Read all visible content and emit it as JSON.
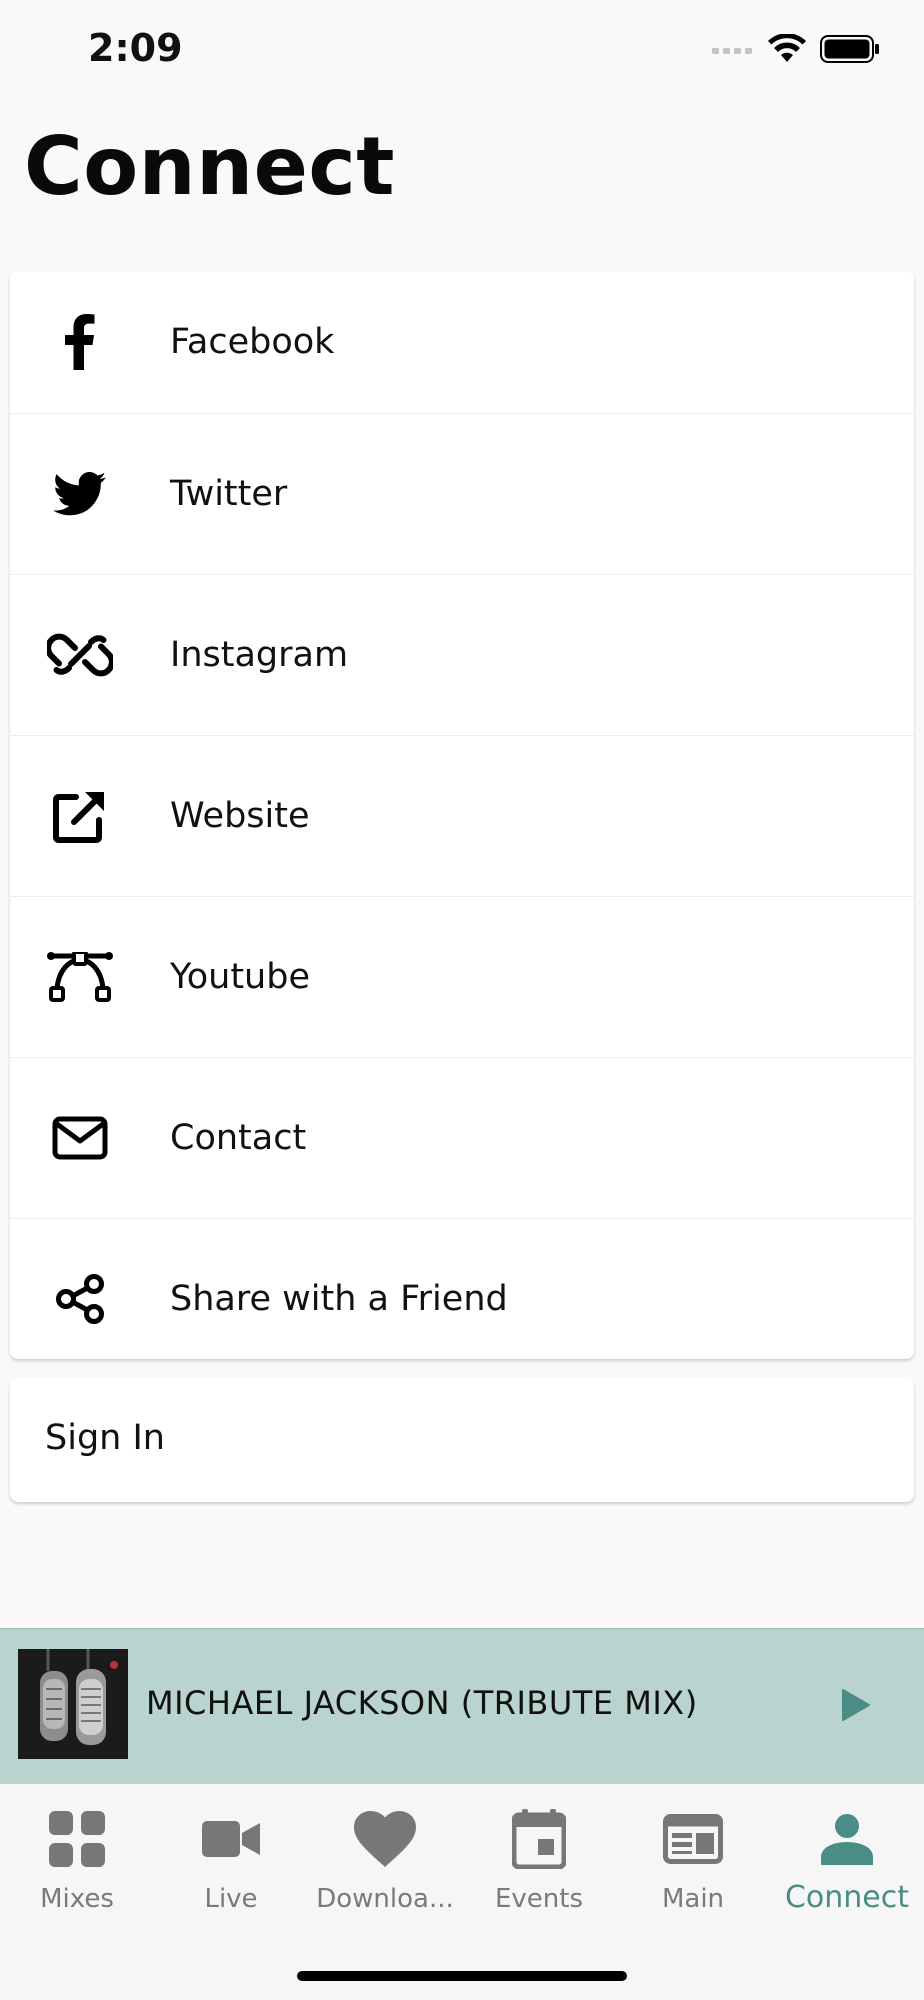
{
  "status_bar": {
    "time": "2:09"
  },
  "page": {
    "title": "Connect"
  },
  "links": [
    {
      "label": "Facebook",
      "icon": "facebook-icon"
    },
    {
      "label": "Twitter",
      "icon": "twitter-icon"
    },
    {
      "label": "Instagram",
      "icon": "link-icon"
    },
    {
      "label": "Website",
      "icon": "external-link-icon"
    },
    {
      "label": "Youtube",
      "icon": "bezier-curve-icon"
    },
    {
      "label": "Contact",
      "icon": "envelope-icon"
    },
    {
      "label": "Share with a Friend",
      "icon": "share-icon"
    }
  ],
  "account": {
    "sign_in_label": "Sign In"
  },
  "player": {
    "track_title": "MICHAEL JACKSON (TRIBUTE MIX)",
    "accent_color": "#4b8d86",
    "background_color": "#b9d4cf"
  },
  "tabs": [
    {
      "label": "Mixes",
      "icon": "grid-icon",
      "active": false
    },
    {
      "label": "Live",
      "icon": "video-camera-icon",
      "active": false
    },
    {
      "label": "Downloa...",
      "icon": "heart-icon",
      "active": false
    },
    {
      "label": "Events",
      "icon": "calendar-icon",
      "active": false
    },
    {
      "label": "Main",
      "icon": "newspaper-icon",
      "active": false
    },
    {
      "label": "Connect",
      "icon": "user-icon",
      "active": true
    }
  ]
}
